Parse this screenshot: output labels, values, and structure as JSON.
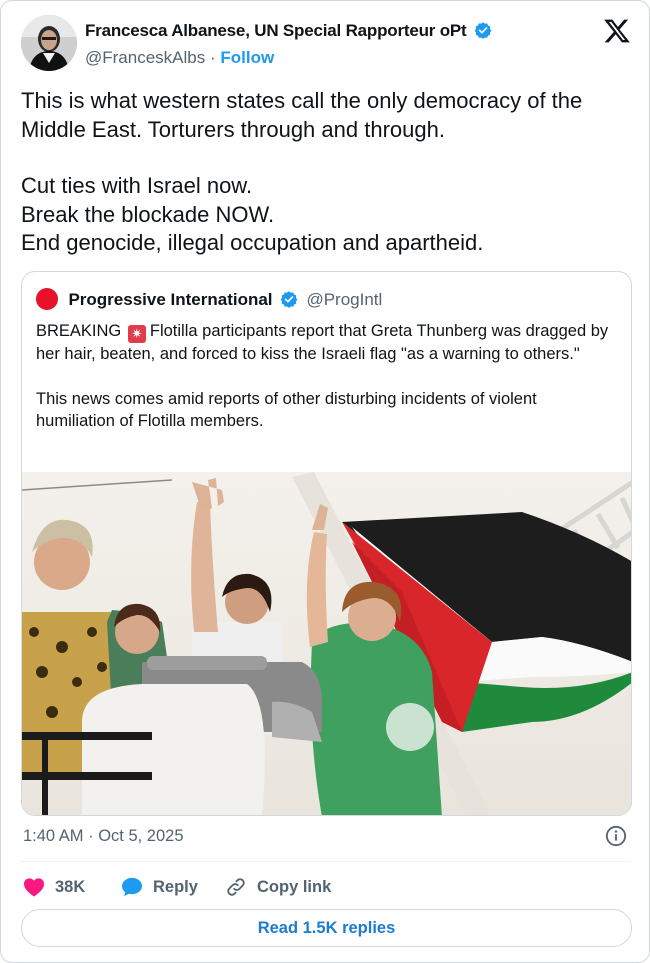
{
  "author": {
    "name": "Francesca Albanese, UN Special Rapporteur oPt",
    "handle": "@FranceskAlbs",
    "separator": "·",
    "follow_label": "Follow"
  },
  "tweet": {
    "paragraphs": [
      "This is what western states call the only democracy of the Middle East. Torturers through and through.",
      "Cut ties with Israel now.\nBreak the blockade NOW.\nEnd genocide, illegal occupation and apartheid."
    ]
  },
  "quote": {
    "name": "Progressive International",
    "handle": "@ProgIntl",
    "breaking_label": "BREAKING",
    "siren_emoji": "🚨",
    "line1_rest": "Flotilla participants report that Greta Thunberg was dragged by her hair, beaten, and forced to kiss the Israeli flag \"as a warning to others.\"",
    "paragraph2": "This news comes amid reports of other disturbing incidents of violent humiliation of Flotilla members.",
    "accent_color": "#e8102b"
  },
  "meta": {
    "timestamp": "1:40 AM · Oct 5, 2025"
  },
  "actions": {
    "likes": "38K",
    "reply_label": "Reply",
    "copy_label": "Copy link",
    "read_replies_label": "Read 1.5K replies"
  },
  "colors": {
    "link_blue": "#1d9bf0",
    "like_pink": "#f91880",
    "muted": "#536471"
  }
}
